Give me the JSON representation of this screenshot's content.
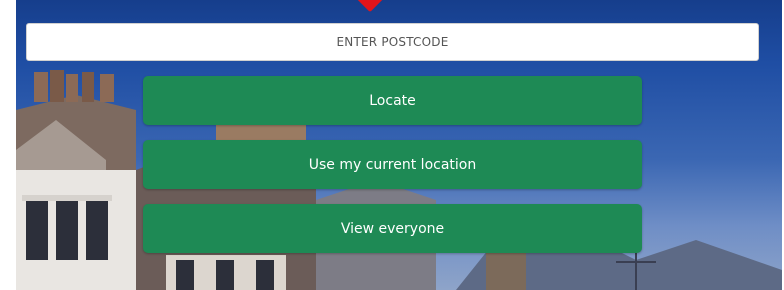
{
  "search": {
    "placeholder": "ENTER POSTCODE"
  },
  "actions": {
    "locate_label": "Locate",
    "current_location_label": "Use my current location",
    "view_everyone_label": "View everyone"
  },
  "colors": {
    "button_green": "#1e8a55",
    "pin_red": "#e3141b",
    "sky_blue": "#1f4ea4"
  },
  "icons": {
    "pin": "map-pin-icon"
  }
}
